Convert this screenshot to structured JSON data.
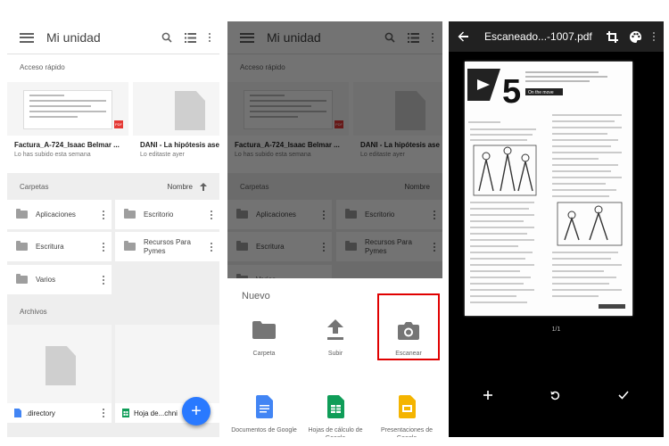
{
  "drive": {
    "title": "Mi unidad",
    "quick_access_label": "Acceso rápido",
    "quick_access": [
      {
        "name": "Factura_A-724_Isaac Belmar ...",
        "subtitle": "Lo has subido esta semana",
        "badge": "PDF"
      },
      {
        "name": "DANI - La hipótesis ase",
        "subtitle": "Lo editaste ayer"
      }
    ],
    "folders_label": "Carpetas",
    "sort_label": "Nombre",
    "folders": [
      "Aplicaciones",
      "Escritorio",
      "Escritura",
      "Recursos Para Pymes",
      "Varios"
    ],
    "files_label": "Archivos",
    "files": [
      ".directory",
      "Hoja de...chni"
    ],
    "fab_label": "+"
  },
  "sheet": {
    "title": "Nuevo",
    "options": [
      {
        "label": "Carpeta",
        "icon": "folder-icon"
      },
      {
        "label": "Subir",
        "icon": "upload-icon"
      },
      {
        "label": "Escanear",
        "icon": "camera-icon"
      },
      {
        "label": "Documentos de Google",
        "icon": "google-docs-icon"
      },
      {
        "label": "Hojas de cálculo de Google",
        "icon": "google-sheets-icon"
      },
      {
        "label": "Presentaciones de Google",
        "icon": "google-slides-icon"
      }
    ]
  },
  "viewer": {
    "title": "Escaneado...-1007.pdf",
    "page_counter": "1/1",
    "scan_big_number": "5",
    "scan_header": "On the move"
  },
  "colors": {
    "accent": "#2979ff",
    "highlight": "#e00000",
    "docs": "#4285f4",
    "sheets": "#0f9d58",
    "slides": "#f4b400"
  }
}
